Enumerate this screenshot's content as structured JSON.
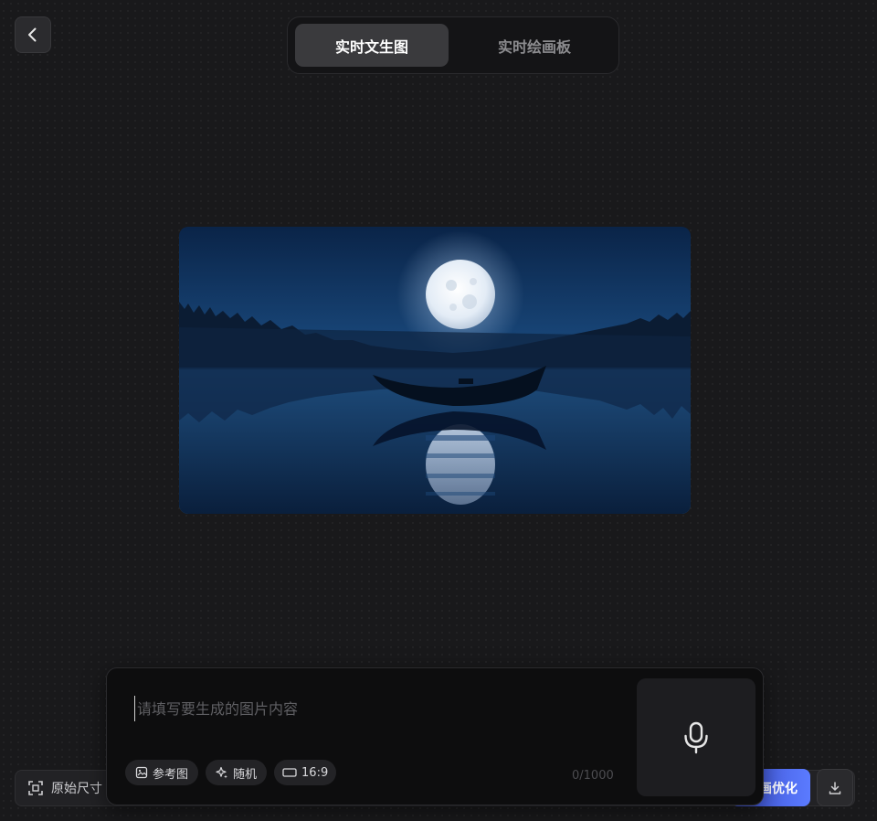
{
  "header": {
    "back_icon": "chevron-left-icon",
    "tabs": [
      {
        "label": "实时文生图",
        "active": true
      },
      {
        "label": "实时绘画板",
        "active": false
      }
    ]
  },
  "preview": {
    "subject": "moonlit-lake-boat-image"
  },
  "prompt": {
    "placeholder": "请填写要生成的图片内容",
    "value": "",
    "char_count": "0/1000",
    "chips": {
      "reference": {
        "label": "参考图",
        "icon": "image-plus-icon"
      },
      "random": {
        "label": "随机",
        "icon": "sparkle-icon"
      },
      "ratio": {
        "label": "16:9",
        "icon": "rectangle-icon"
      }
    },
    "mic_icon": "microphone-icon"
  },
  "toolbar": {
    "original_size": "原始尺寸",
    "optimize": "画优化",
    "download_icon": "download-icon"
  },
  "colors": {
    "background": "#19191b",
    "accent": "#5b7bff",
    "active_tab": "#3a3a3d"
  }
}
